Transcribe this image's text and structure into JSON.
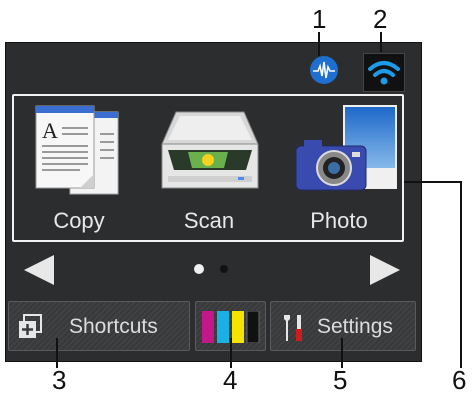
{
  "callouts": [
    "1",
    "2",
    "3",
    "4",
    "5",
    "6"
  ],
  "apps": [
    {
      "label": "Copy",
      "icon": "copy-document-icon"
    },
    {
      "label": "Scan",
      "icon": "scanner-icon"
    },
    {
      "label": "Photo",
      "icon": "camera-photo-icon"
    }
  ],
  "status": {
    "network_icon": "wired-network-icon",
    "wifi_icon": "wifi-icon"
  },
  "pager": {
    "pages": 2,
    "current": 1
  },
  "bottom": {
    "shortcuts_label": "Shortcuts",
    "ink_icon": "ink-cartridges-icon",
    "settings_label": "Settings"
  },
  "colors": {
    "screen_bg": "#2c2d2f",
    "accent_blue": "#1f6fd1",
    "ink": [
      "#c2188a",
      "#1ab0e6",
      "#f5e400",
      "#111111"
    ]
  }
}
